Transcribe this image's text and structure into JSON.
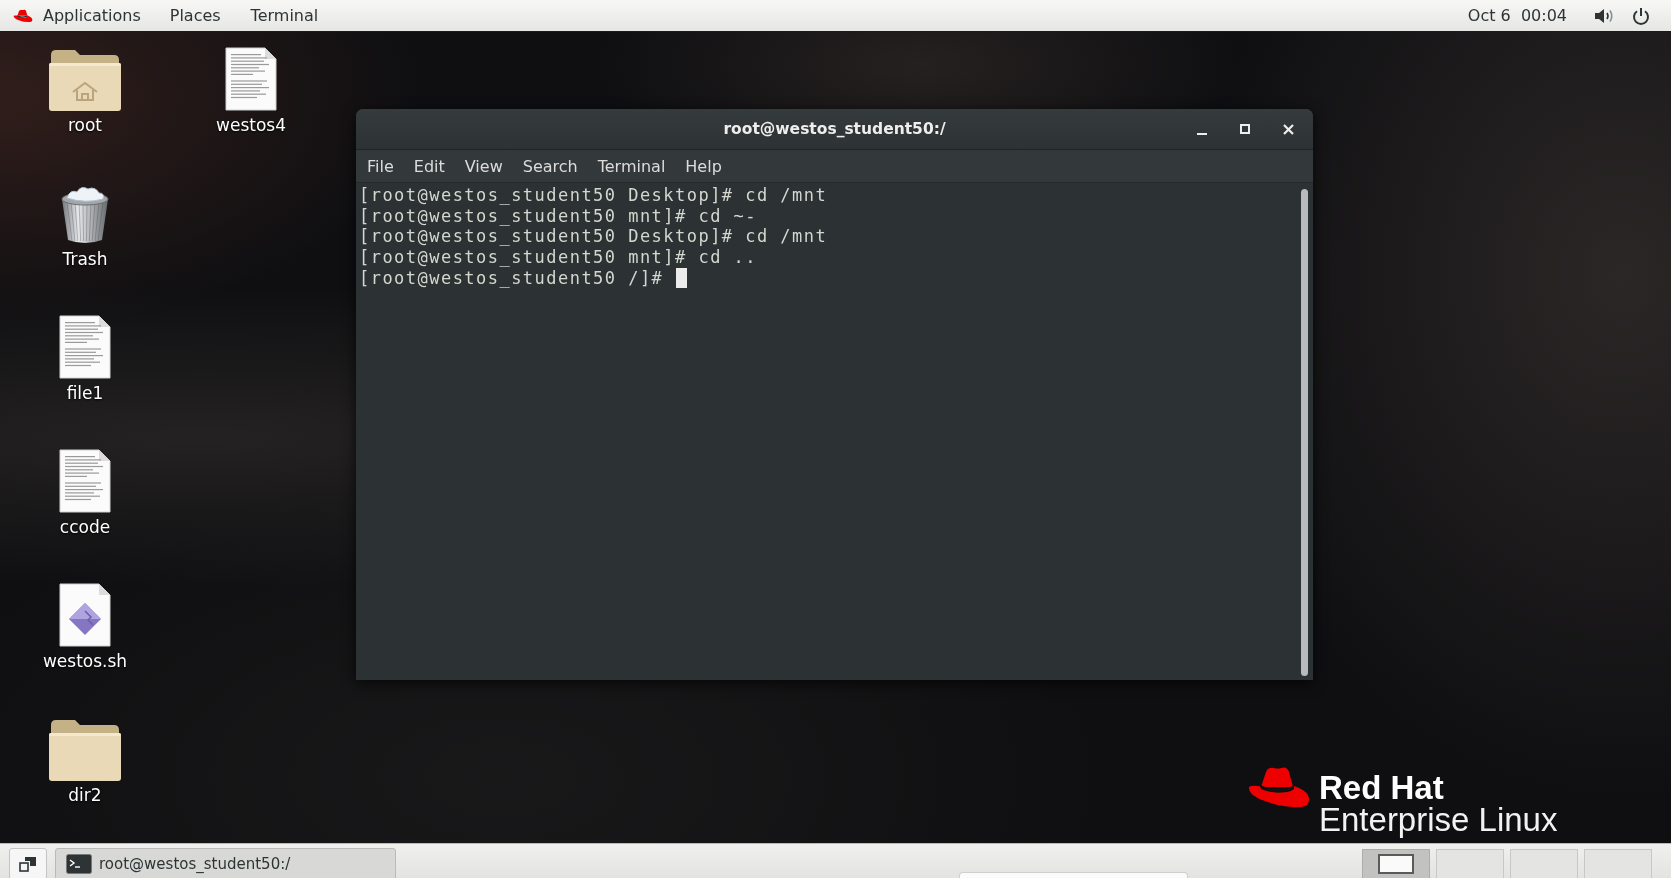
{
  "top_bar": {
    "applications_menu": "Applications",
    "menus": [
      "Places",
      "Terminal"
    ],
    "clock": "Oct 6  00:04"
  },
  "desktop": {
    "columns": [
      {
        "icons": [
          {
            "label": "root",
            "kind": "home"
          },
          {
            "label": "Trash",
            "kind": "trash"
          },
          {
            "label": "file1",
            "kind": "document"
          },
          {
            "label": "ccode",
            "kind": "document"
          },
          {
            "label": "westos.sh",
            "kind": "script"
          },
          {
            "label": "dir2",
            "kind": "folder"
          }
        ]
      },
      {
        "icons": [
          {
            "label": "westos4",
            "kind": "document"
          }
        ]
      }
    ]
  },
  "terminal_window": {
    "title": "root@westos_student50:/",
    "menu": [
      "File",
      "Edit",
      "View",
      "Search",
      "Terminal",
      "Help"
    ],
    "lines": [
      "[root@westos_student50 Desktop]# cd /mnt",
      "[root@westos_student50 mnt]# cd ~-",
      "[root@westos_student50 Desktop]# cd /mnt",
      "[root@westos_student50 mnt]# cd ..",
      "[root@westos_student50 /]#"
    ],
    "cursor": true
  },
  "brand": {
    "name": "Red Hat",
    "product": "Enterprise Linux"
  },
  "taskbar": {
    "windows": [
      {
        "title": "root@westos_student50:/"
      }
    ],
    "workspaces": [
      {
        "selected": true,
        "has_window": true
      },
      {
        "selected": false,
        "has_window": false
      },
      {
        "selected": false,
        "has_window": false
      },
      {
        "selected": false,
        "has_window": false
      }
    ]
  }
}
